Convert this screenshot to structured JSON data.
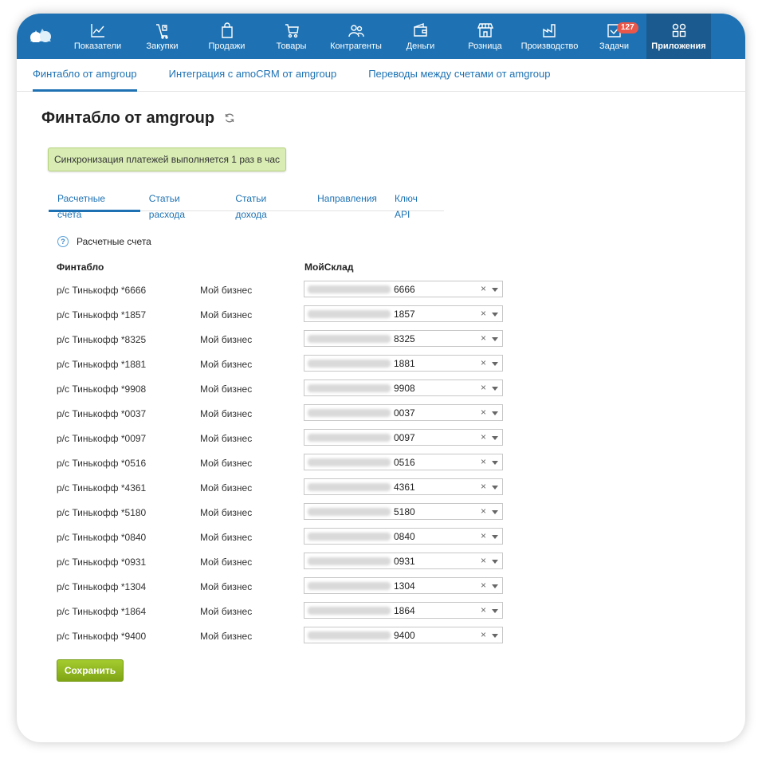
{
  "nav": {
    "items": [
      {
        "label": "Показатели",
        "icon": "chart-icon"
      },
      {
        "label": "Закупки",
        "icon": "purchase-icon"
      },
      {
        "label": "Продажи",
        "icon": "bag-icon"
      },
      {
        "label": "Товары",
        "icon": "cart-icon"
      },
      {
        "label": "Контрагенты",
        "icon": "people-icon"
      },
      {
        "label": "Деньги",
        "icon": "wallet-icon"
      },
      {
        "label": "Розница",
        "icon": "store-icon"
      },
      {
        "label": "Производство",
        "icon": "factory-icon"
      },
      {
        "label": "Задачи",
        "icon": "task-icon",
        "badge": "127"
      },
      {
        "label": "Приложения",
        "icon": "apps-icon",
        "active": true
      }
    ]
  },
  "subnav": {
    "tabs": [
      {
        "label": "Финтабло от amgroup",
        "active": true
      },
      {
        "label": "Интеграция с amoCRM от amgroup"
      },
      {
        "label": "Переводы между счетами от amgroup"
      }
    ]
  },
  "page": {
    "title": "Финтабло от amgroup",
    "banner": "Синхронизация платежей выполняется 1 раз в час"
  },
  "tabs": [
    {
      "label": "Расчетные счета",
      "active": true
    },
    {
      "label": "Статьи расхода"
    },
    {
      "label": "Статьи дохода"
    },
    {
      "label": "Направления"
    },
    {
      "label": "Ключ API"
    }
  ],
  "section": {
    "help": "?",
    "label": "Расчетные счета",
    "col_left": "Финтабло",
    "col_right": "МойСклад"
  },
  "rows": [
    {
      "account": "р/с Тинькофф *6666",
      "business": "Мой бизнес",
      "value": "6666"
    },
    {
      "account": "р/с Тинькофф *1857",
      "business": "Мой бизнес",
      "value": "1857"
    },
    {
      "account": "р/с Тинькофф *8325",
      "business": "Мой бизнес",
      "value": "8325"
    },
    {
      "account": "р/с Тинькофф *1881",
      "business": "Мой бизнес",
      "value": "1881"
    },
    {
      "account": "р/с Тинькофф *9908",
      "business": "Мой бизнес",
      "value": "9908"
    },
    {
      "account": "р/с Тинькофф *0037",
      "business": "Мой бизнес",
      "value": "0037"
    },
    {
      "account": "р/с Тинькофф *0097",
      "business": "Мой бизнес",
      "value": "0097"
    },
    {
      "account": "р/с Тинькофф *0516",
      "business": "Мой бизнес",
      "value": "0516"
    },
    {
      "account": "р/с Тинькофф *4361",
      "business": "Мой бизнес",
      "value": "4361"
    },
    {
      "account": "р/с Тинькофф *5180",
      "business": "Мой бизнес",
      "value": "5180"
    },
    {
      "account": "р/с Тинькофф *0840",
      "business": "Мой бизнес",
      "value": "0840"
    },
    {
      "account": "р/с Тинькофф *0931",
      "business": "Мой бизнес",
      "value": "0931"
    },
    {
      "account": "р/с Тинькофф *1304",
      "business": "Мой бизнес",
      "value": "1304"
    },
    {
      "account": "р/с Тинькофф *1864",
      "business": "Мой бизнес",
      "value": "1864"
    },
    {
      "account": "р/с Тинькофф *9400",
      "business": "Мой бизнес",
      "value": "9400"
    }
  ],
  "select": {
    "clear": "×"
  },
  "actions": {
    "save_label": "Сохранить"
  },
  "colors": {
    "nav_bg": "#1e72b3",
    "nav_active_bg": "#1a5a8e",
    "link": "#1e72b3",
    "banner_bg": "#d8ecb4",
    "save_btn": "#8fb71f",
    "badge": "#e9574a"
  }
}
